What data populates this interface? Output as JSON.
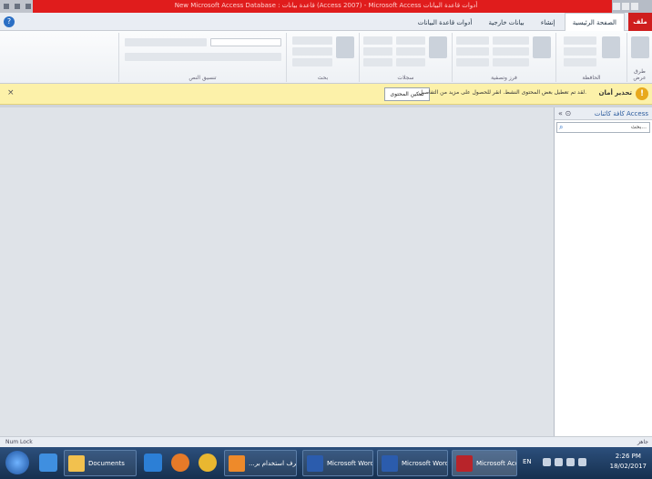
{
  "window": {
    "title": "New Microsoft Access Database : قاعدة بيانات (Access 2007) - Microsoft Access أدوات قاعدة البيانات"
  },
  "ribbon": {
    "file_tab": "ملف",
    "tabs": [
      "الصفحة الرئيسية",
      "إنشاء",
      "بيانات خارجية",
      "أدوات قاعدة البيانات"
    ],
    "groups": [
      "طرق عرض",
      "الحافظة",
      "فرز وتصفية",
      "سجلات",
      "بحث",
      "تنسيق النص"
    ]
  },
  "security_bar": {
    "title": "تحذير أمان",
    "message": "لقد تم تعطيل بعض المحتوى النشط. انقر للحصول على مزيد من التفاصيل.",
    "enable_button": "تمكين المحتوى",
    "close_label": "×"
  },
  "nav_pane": {
    "title": "كافة كائنات Access",
    "search_placeholder": "بحث..."
  },
  "status_bar": {
    "left": "Num Lock",
    "right": "جاهز"
  },
  "taskbar": {
    "buttons": [
      "Documents",
      "...اعرف استخدام بر",
      "Microsoft Word ...",
      "Microsoft Word ...",
      "Microsoft Acces..."
    ],
    "language": "EN",
    "time": "2:26 PM",
    "date": "18/02/2017"
  },
  "colors": {
    "accent": "#cf1e1e",
    "security_bar": "#fcf1a9",
    "taskbar": "#1f3c63"
  }
}
